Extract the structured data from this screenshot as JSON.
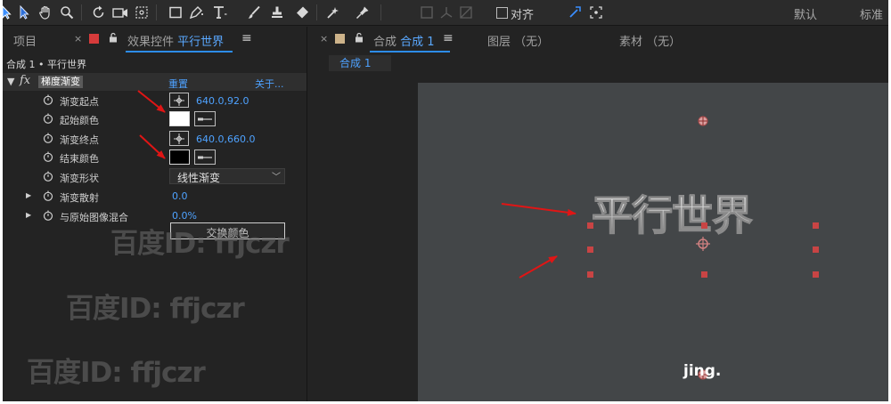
{
  "toolbar": {
    "snap_label": "对齐",
    "workspace_default": "默认",
    "workspace_standard": "标准"
  },
  "left_panel": {
    "tab_project": "项目",
    "tab_effects_prefix": "效果控件",
    "tab_effects_layer": "平行世界",
    "tab_close": "×",
    "menu_glyph": "≡",
    "comp_path": "合成 1 • 平行世界",
    "effect": {
      "name": "梯度渐变",
      "reset_label": "重置",
      "about_label": "关于..."
    },
    "properties": {
      "ramp_start": {
        "label": "渐变起点",
        "value": "640.0,92.0"
      },
      "start_color": {
        "label": "起始颜色",
        "color": "#ffffff"
      },
      "ramp_end": {
        "label": "渐变终点",
        "value": "640.0,660.0"
      },
      "end_color": {
        "label": "结束颜色",
        "color": "#000000"
      },
      "ramp_shape": {
        "label": "渐变形状",
        "value": "线性渐变"
      },
      "ramp_scatter": {
        "label": "渐变散射",
        "value": "0.0"
      },
      "blend": {
        "label": "与原始图像混合",
        "value": "0.0%"
      }
    },
    "swap_button_label": "交换颜色"
  },
  "right_panel": {
    "tab_close": "×",
    "tab_comp_prefix": "合成",
    "tab_comp_name": "合成 1",
    "menu_glyph": "≡",
    "tab_layer": "图层 （无）",
    "tab_footage": "素材 （无）",
    "comp_chip_label": "合成 1",
    "layer_text": "平行世界"
  },
  "watermark_text": "百度ID: ffjczr",
  "corner_logo": "jing.",
  "colors": {
    "accent_blue": "#2d8ceb",
    "value_blue": "#4ea2ff",
    "arrow_red": "#e01515",
    "handle_red": "#c84444"
  }
}
